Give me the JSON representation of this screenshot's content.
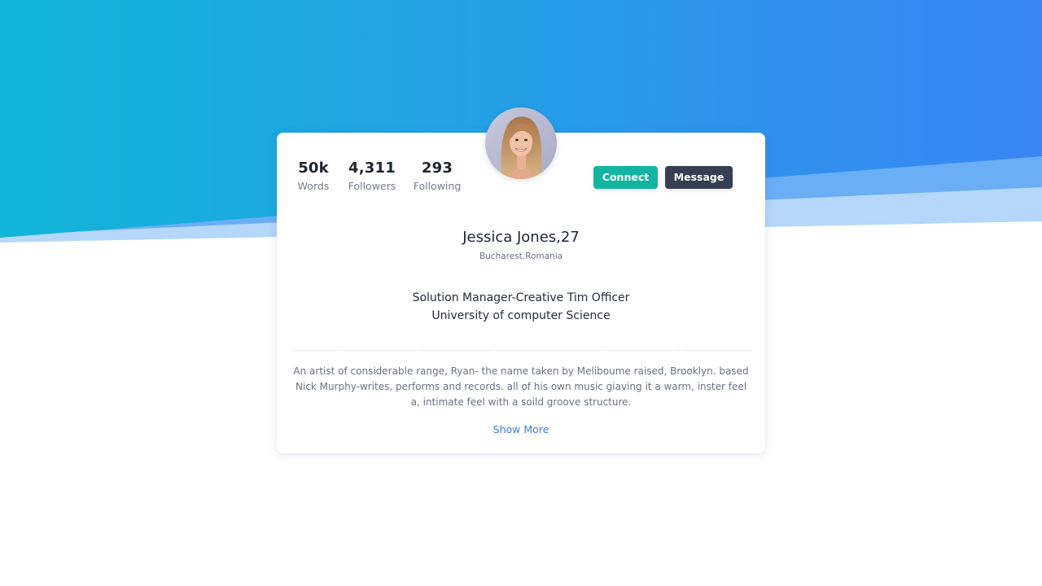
{
  "colors": {
    "hero_gradient_start": "#11b5d8",
    "hero_gradient_end": "#3a86f5",
    "connect_button": "#12b5a1",
    "message_button": "#363f52",
    "link": "#3b7be0"
  },
  "profile": {
    "avatar_icon": "profile-photo",
    "stats": [
      {
        "value": "50k",
        "label": "Words"
      },
      {
        "value": "4,311",
        "label": "Followers"
      },
      {
        "value": "293",
        "label": "Following"
      }
    ],
    "actions": {
      "connect_label": "Connect",
      "message_label": "Message"
    },
    "name": "Jessica Jones,27",
    "location": "Bucharest,Romania",
    "job_title": "Solution Manager-Creative Tim Officer",
    "education": "University of computer Science",
    "bio": "An artist of considerable range, Ryan- the name taken by Meliboume raised, Brooklyn. based Nick Murphy-writes, performs and records. all of his own music giaving it a warm, inster feel a, intimate feel with a soild groove structure.",
    "show_more_label": "Show More"
  }
}
